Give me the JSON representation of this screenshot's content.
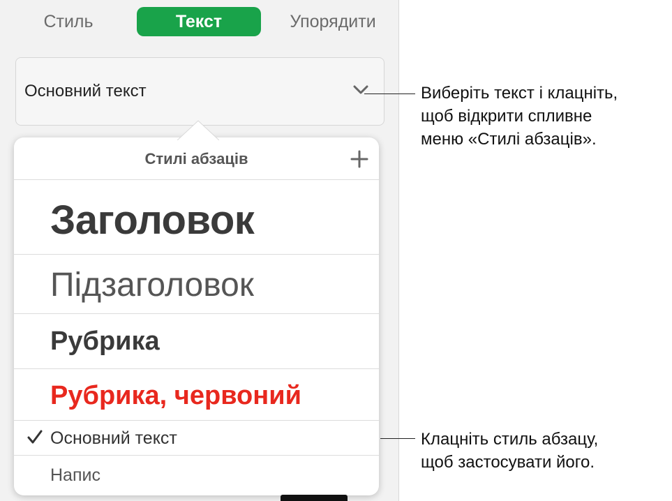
{
  "tabs": [
    {
      "label": "Стиль",
      "active": false
    },
    {
      "label": "Текст",
      "active": true
    },
    {
      "label": "Упорядити",
      "active": false
    }
  ],
  "accent_color": "#19a34a",
  "dropdown": {
    "label": "Основний текст",
    "icon": "chevron-down-icon"
  },
  "popover": {
    "title": "Стилі абзаців",
    "add_icon": "plus-icon",
    "items": [
      {
        "label": "Заголовок",
        "selected": false
      },
      {
        "label": "Підзаголовок",
        "selected": false
      },
      {
        "label": "Рубрика",
        "selected": false
      },
      {
        "label": "Рубрика, червоний",
        "selected": false,
        "color": "#e8281e"
      },
      {
        "label": "Основний текст",
        "selected": true
      },
      {
        "label": "Напис",
        "selected": false
      }
    ]
  },
  "callouts": {
    "top": [
      "Виберіть текст і клацніть,",
      "щоб відкрити спливне",
      "меню «Стилі абзаців»."
    ],
    "bottom": [
      "Клацніть стиль абзацу,",
      "щоб застосувати його."
    ]
  }
}
